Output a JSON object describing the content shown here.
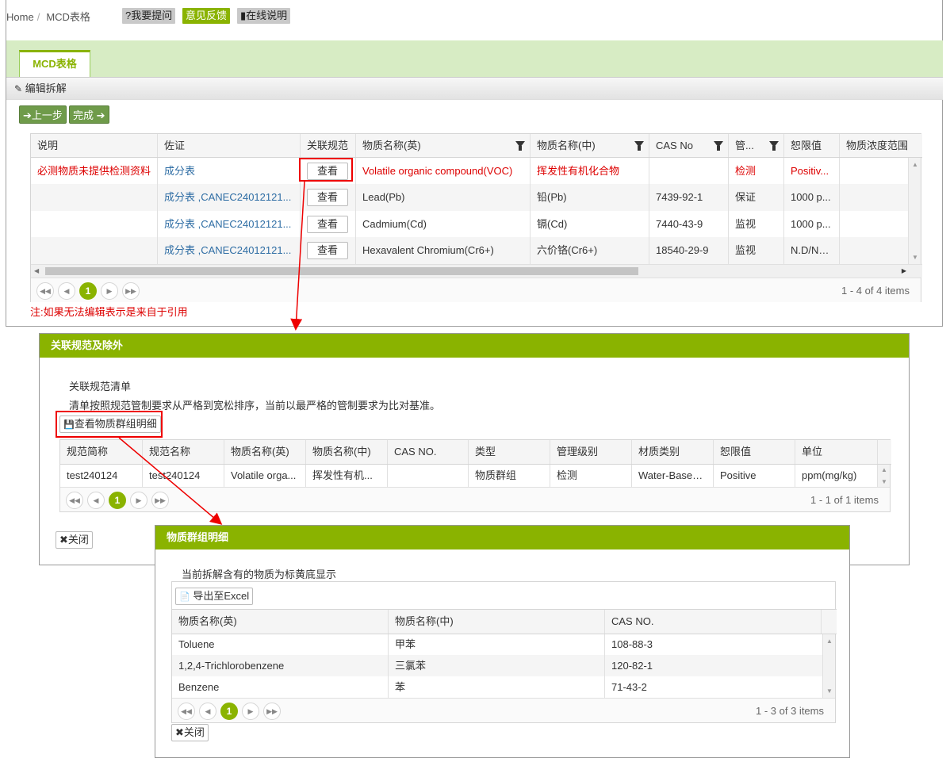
{
  "breadcrumb": {
    "home": "Home",
    "sep": "/",
    "current": "MCD表格"
  },
  "toolbar": {
    "ask": "?我要提问",
    "feedback": "意见反馈",
    "help": "在线说明"
  },
  "tab": {
    "label": "MCD表格"
  },
  "subbar": {
    "label": "编辑拆解"
  },
  "nav": {
    "prev": "上一步",
    "finish": "完成"
  },
  "main_grid": {
    "headers": [
      "说明",
      "佐证",
      "关联规范",
      "物质名称(英)",
      "物质名称(中)",
      "CAS No",
      "管...",
      "恕限值",
      "物质浓度范围"
    ],
    "view_label": "查看",
    "rows": [
      {
        "desc": "必测物质未提供检测资料",
        "evidence": "成分表",
        "en": "Volatile organic compound(VOC)",
        "cn": "挥发性有机化合物",
        "cas": "",
        "mgmt": "检测",
        "limit": "Positiv..."
      },
      {
        "desc": "",
        "evidence": "成分表 ,CANEC24012121...",
        "en": "Lead(Pb)",
        "cn": "铅(Pb)",
        "cas": "7439-92-1",
        "mgmt": "保证",
        "limit": "1000 p..."
      },
      {
        "desc": "",
        "evidence": "成分表 ,CANEC24012121...",
        "en": "Cadmium(Cd)",
        "cn": "镉(Cd)",
        "cas": "7440-43-9",
        "mgmt": "监视",
        "limit": "1000 p..."
      },
      {
        "desc": "",
        "evidence": "成分表 ,CANEC24012121...",
        "en": "Hexavalent Chromium(Cr6+)",
        "cn": "六价铬(Cr6+)",
        "cas": "18540-29-9",
        "mgmt": "监视",
        "limit": "N.D/Ne..."
      }
    ],
    "pager": {
      "page": "1",
      "info": "1 - 4 of 4 items"
    }
  },
  "note": "注:如果无法编辑表示是来自于引用",
  "dialog1": {
    "title": "关联规范及除外",
    "heading": "关联规范清单",
    "desc": "清单按照规范管制要求从严格到宽松排序，当前以最严格的管制要求为比对基准。",
    "group_btn": "查看物质群组明细",
    "headers": [
      "规范简称",
      "规范名称",
      "物质名称(英)",
      "物质名称(中)",
      "CAS NO.",
      "类型",
      "管理级别",
      "材质类别",
      "恕限值",
      "单位"
    ],
    "rows": [
      [
        "test240124",
        "test240124",
        "Volatile orga...",
        "挥发性有机...",
        "",
        "物质群组",
        "检测",
        "Water-Based...",
        "Positive",
        "ppm(mg/kg)"
      ]
    ],
    "pager": {
      "page": "1",
      "info": "1 - 1 of 1 items"
    },
    "close": "关闭"
  },
  "dialog2": {
    "title": "物质群组明细",
    "desc": "当前拆解含有的物质为标黄底显示",
    "export": "导出至Excel",
    "headers": [
      "物质名称(英)",
      "物质名称(中)",
      "CAS NO."
    ],
    "rows": [
      [
        "Toluene",
        "甲苯",
        "108-88-3"
      ],
      [
        "1,2,4-Trichlorobenzene",
        "三氯苯",
        "120-82-1"
      ],
      [
        "Benzene",
        "苯",
        "71-43-2"
      ]
    ],
    "pager": {
      "page": "1",
      "info": "1 - 3 of 3 items"
    },
    "close": "关闭"
  },
  "colors": {
    "accent": "#8ab300",
    "nav_green": "#6f9b4a",
    "tab_band": "#d7ecc4",
    "alert_red": "#dd0000",
    "link": "#2e6da4"
  }
}
